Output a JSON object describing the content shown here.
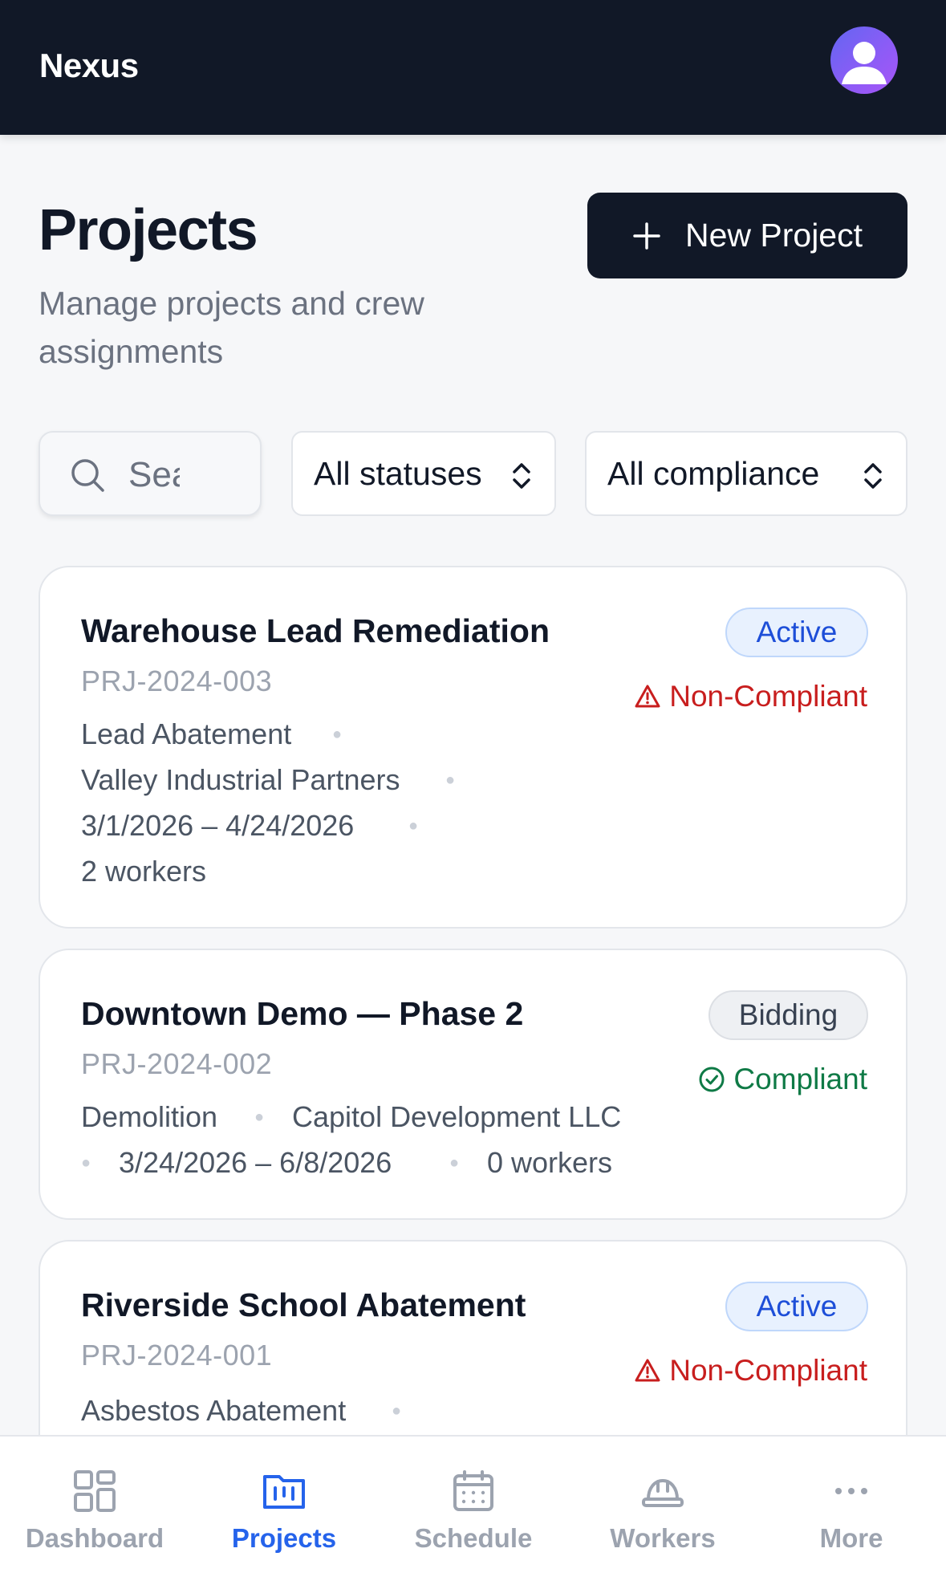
{
  "app": {
    "title": "Nexus"
  },
  "header": {
    "title": "Projects",
    "subtitle": "Manage projects and crew assignments",
    "new_button_label": "New Project"
  },
  "filters": {
    "search_placeholder": "Search",
    "status_selected": "All statuses",
    "compliance_selected": "All compliance"
  },
  "projects": [
    {
      "name": "Warehouse Lead Remediation",
      "code": "PRJ-2024-003",
      "type": "Lead Abatement",
      "client": "Valley Industrial Partners",
      "dates": "3/1/2026 – 4/24/2026",
      "workers": "2 workers",
      "status": "Active",
      "compliance": "Non-Compliant"
    },
    {
      "name": "Downtown Demo — Phase 2",
      "code": "PRJ-2024-002",
      "type": "Demolition",
      "client": "Capitol Development LLC",
      "dates": "3/24/2026 – 6/8/2026",
      "workers": "0 workers",
      "status": "Bidding",
      "compliance": "Compliant"
    },
    {
      "name": "Riverside School Abatement",
      "code": "PRJ-2024-001",
      "type": "Asbestos Abatement",
      "status": "Active",
      "compliance": "Non-Compliant"
    }
  ],
  "bottom_nav": [
    {
      "label": "Dashboard",
      "icon": "grid-icon"
    },
    {
      "label": "Projects",
      "icon": "folder-icon",
      "active": true
    },
    {
      "label": "Schedule",
      "icon": "calendar-icon"
    },
    {
      "label": "Workers",
      "icon": "hard-hat-icon"
    },
    {
      "label": "More",
      "icon": "more-dots-icon"
    }
  ],
  "colors": {
    "header_bg": "#111827",
    "accent": "#2563eb",
    "active_badge": "#1d4ed8",
    "non_compliant": "#c81e1e",
    "compliant": "#0f7a46"
  }
}
